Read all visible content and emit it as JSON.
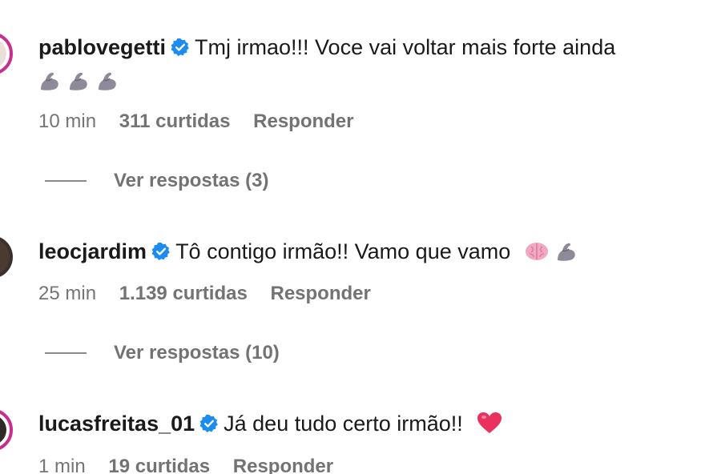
{
  "comments": [
    {
      "username": "pablovegetti",
      "text": "Tmj irmao!!! Voce vai voltar mais forte ainda",
      "emojis": [
        "flexed-biceps",
        "flexed-biceps",
        "flexed-biceps"
      ],
      "time": "10 min",
      "likes": "311 curtidas",
      "reply": "Responder",
      "view_replies": "Ver respostas (3)"
    },
    {
      "username": "leocjardim",
      "text": "Tô contigo irmão!! Vamo que vamo",
      "emojis": [
        "brain",
        "flexed-biceps"
      ],
      "time": "25 min",
      "likes": "1.139 curtidas",
      "reply": "Responder",
      "view_replies": "Ver respostas (10)"
    },
    {
      "username": "lucasfreitas_01",
      "text": "Já deu tudo certo irmão!!",
      "emojis": [
        "red-heart"
      ],
      "time": "1 min",
      "likes": "19 curtidas",
      "reply": "Responder"
    }
  ],
  "colors": {
    "verified_badge": "#1d8cf0",
    "story_ring": "#c72e8f",
    "meta_text": "#737373"
  }
}
